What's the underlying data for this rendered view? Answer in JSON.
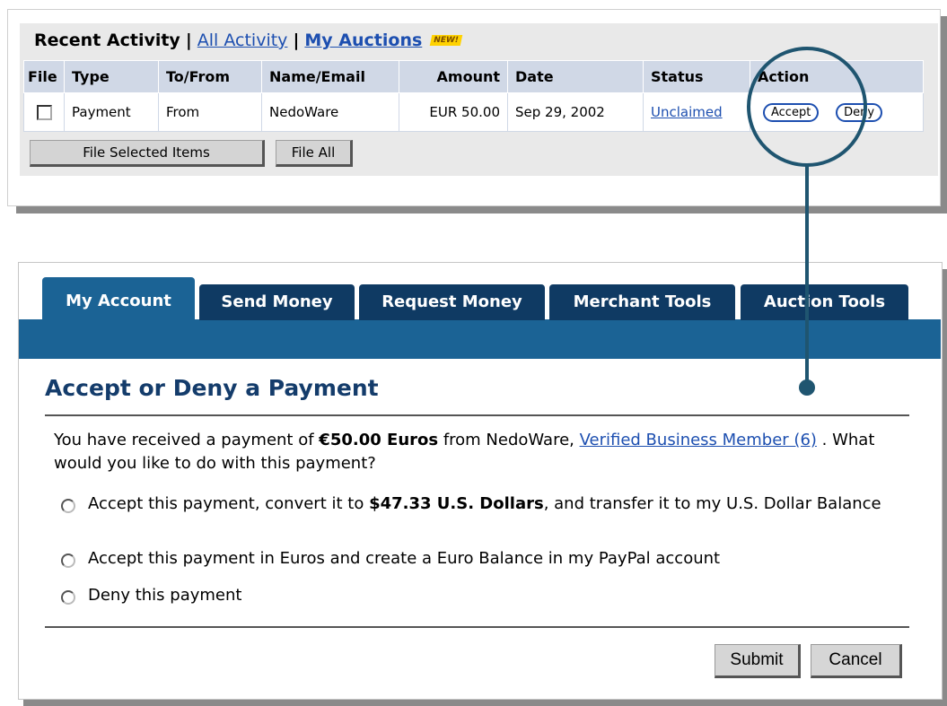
{
  "recent_activity": {
    "title": "Recent Activity",
    "separator": "|",
    "all_activity_link": "All Activity",
    "my_auctions_link": "My Auctions",
    "new_badge": "NEW!",
    "columns": [
      "File",
      "Type",
      "To/From",
      "Name/Email",
      "Amount",
      "Date",
      "Status",
      "Action"
    ],
    "row": {
      "type": "Payment",
      "to_from": "From",
      "name": "NedoWare",
      "amount": "EUR 50.00",
      "date": "Sep 29, 2002",
      "status": "Unclaimed",
      "accept_label": "Accept",
      "deny_label": "Deny"
    },
    "file_selected_label": "File Selected Items",
    "file_all_label": "File All"
  },
  "tabs": [
    {
      "label": "My Account",
      "active": true
    },
    {
      "label": "Send Money",
      "active": false
    },
    {
      "label": "Request Money",
      "active": false
    },
    {
      "label": "Merchant Tools",
      "active": false
    },
    {
      "label": "Auction Tools",
      "active": false
    }
  ],
  "form": {
    "title": "Accept or Deny a Payment",
    "intro_pre": "You have received a payment of ",
    "intro_amount": "€50.00 Euros",
    "intro_mid": " from NedoWare, ",
    "intro_link": "Verified Business Member (6)",
    "intro_post": " . What would you like to do with this payment?",
    "options": {
      "convert_pre": "Accept this payment, convert it to ",
      "convert_amount": "$47.33 U.S. Dollars",
      "convert_post": ", and transfer it to my U.S. Dollar Balance",
      "euro": "Accept this payment in Euros and create a Euro Balance in my PayPal account",
      "deny": "Deny this payment"
    },
    "submit_label": "Submit",
    "cancel_label": "Cancel"
  },
  "colors": {
    "tab_dark": "#0f3a63",
    "tab_active": "#1b6395",
    "link": "#1d4fb0",
    "title": "#143c6b",
    "magnifier": "#1f5570"
  }
}
